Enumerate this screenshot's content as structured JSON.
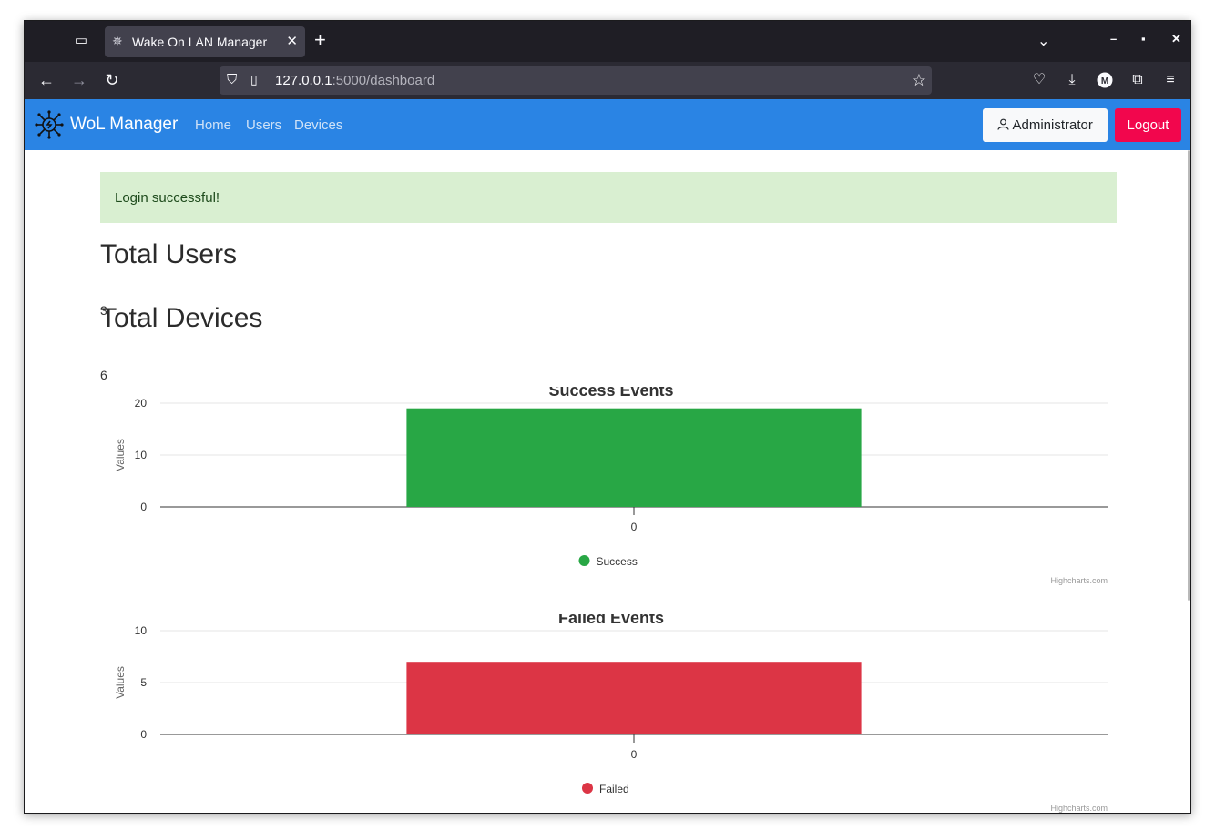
{
  "browser": {
    "tab_title": "Wake On LAN Manager",
    "url_host": "127.0.0.1",
    "url_path": ":5000/dashboard"
  },
  "app": {
    "brand": "WoL Manager",
    "nav": [
      "Home",
      "Users",
      "Devices"
    ],
    "user_button": "Administrator",
    "logout_button": "Logout",
    "accent_color": "#2a84e4",
    "logout_color": "#f2064d"
  },
  "alert": "Login successful!",
  "stats": {
    "users_heading": "Total Users",
    "users_value": "3",
    "devices_heading": "Total Devices",
    "devices_value": "6"
  },
  "chart_data": [
    {
      "type": "bar",
      "title": "Success Events",
      "categories": [
        "0"
      ],
      "series": [
        {
          "name": "Success",
          "values": [
            19
          ],
          "color": "#28a745"
        }
      ],
      "ylabel": "Values",
      "ylim": [
        0,
        20
      ],
      "yticks": [
        0,
        10,
        20
      ],
      "credit": "Highcharts.com",
      "legend": "bottom-center",
      "grid": true
    },
    {
      "type": "bar",
      "title": "Failed Events",
      "categories": [
        "0"
      ],
      "series": [
        {
          "name": "Failed",
          "values": [
            7
          ],
          "color": "#dc3545"
        }
      ],
      "ylabel": "Values",
      "ylim": [
        0,
        10
      ],
      "yticks": [
        0,
        5,
        10
      ],
      "credit": "Highcharts.com",
      "legend": "bottom-center",
      "grid": true
    }
  ]
}
